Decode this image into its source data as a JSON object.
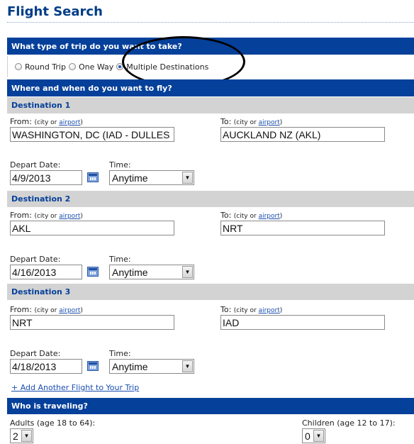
{
  "page": {
    "title": "Flight Search"
  },
  "trip_type": {
    "question": "What type of trip do you want to take?",
    "options": [
      "Round Trip",
      "One Way",
      "Multiple Destinations"
    ],
    "selected": "Multiple Destinations"
  },
  "where_when": {
    "heading": "Where and when do you want to fly?"
  },
  "labels": {
    "from": "From:",
    "to": "To:",
    "city_or": "(city or",
    "airport": "airport",
    "close_paren": ")",
    "depart_date": "Depart Date:",
    "time": "Time:"
  },
  "destinations": [
    {
      "heading": "Destination 1",
      "from": "WASHINGTON, DC (IAD - DULLES",
      "to": "AUCKLAND NZ (AKL)",
      "depart_date": "4/9/2013",
      "time": "Anytime"
    },
    {
      "heading": "Destination 2",
      "from": "AKL",
      "to": "NRT",
      "depart_date": "4/16/2013",
      "time": "Anytime"
    },
    {
      "heading": "Destination 3",
      "from": "NRT",
      "to": "IAD",
      "depart_date": "4/18/2013",
      "time": "Anytime"
    }
  ],
  "add_flight_link": "+ Add Another Flight to Your Trip",
  "travelers": {
    "heading": "Who is traveling?",
    "adults_label": "Adults (age 18 to 64):",
    "adults_value": "2",
    "children_label": "Children (age 12 to 17):",
    "children_value": "0"
  },
  "icons": {
    "calendar": "calendar-icon",
    "dropdown": "chevron-down-icon"
  }
}
